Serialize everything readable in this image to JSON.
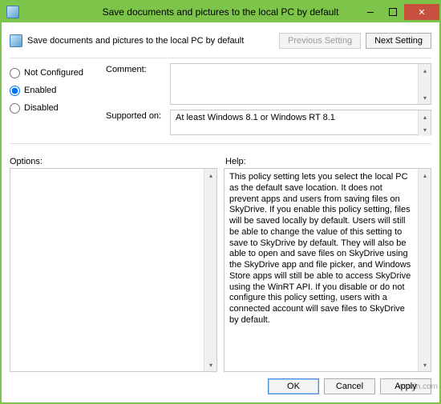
{
  "window": {
    "title": "Save documents and pictures to the local PC by default"
  },
  "header": {
    "title": "Save documents and pictures to the local PC by default",
    "prev_label": "Previous Setting",
    "next_label": "Next Setting"
  },
  "radios": {
    "not_configured": "Not Configured",
    "enabled": "Enabled",
    "disabled": "Disabled",
    "selected": "enabled"
  },
  "fields": {
    "comment_label": "Comment:",
    "comment_value": "",
    "supported_label": "Supported on:",
    "supported_value": "At least Windows 8.1 or Windows RT 8.1"
  },
  "panels": {
    "options_label": "Options:",
    "help_label": "Help:",
    "options_text": "",
    "help_text": "This policy setting lets you select the local PC as the default save location. It does not prevent apps and users from saving files on SkyDrive. If you enable this policy setting, files will be saved locally by default. Users will still be able to change the value of this setting to save to SkyDrive by default. They will also be able to open and save files on SkyDrive using the SkyDrive app and file picker, and Windows Store apps will still be able to access SkyDrive using the WinRT API. If you disable or do not configure this policy setting, users with a connected account will save files to SkyDrive by default."
  },
  "footer": {
    "ok": "OK",
    "cancel": "Cancel",
    "apply": "Apply"
  },
  "watermark": "wsxdn.com"
}
